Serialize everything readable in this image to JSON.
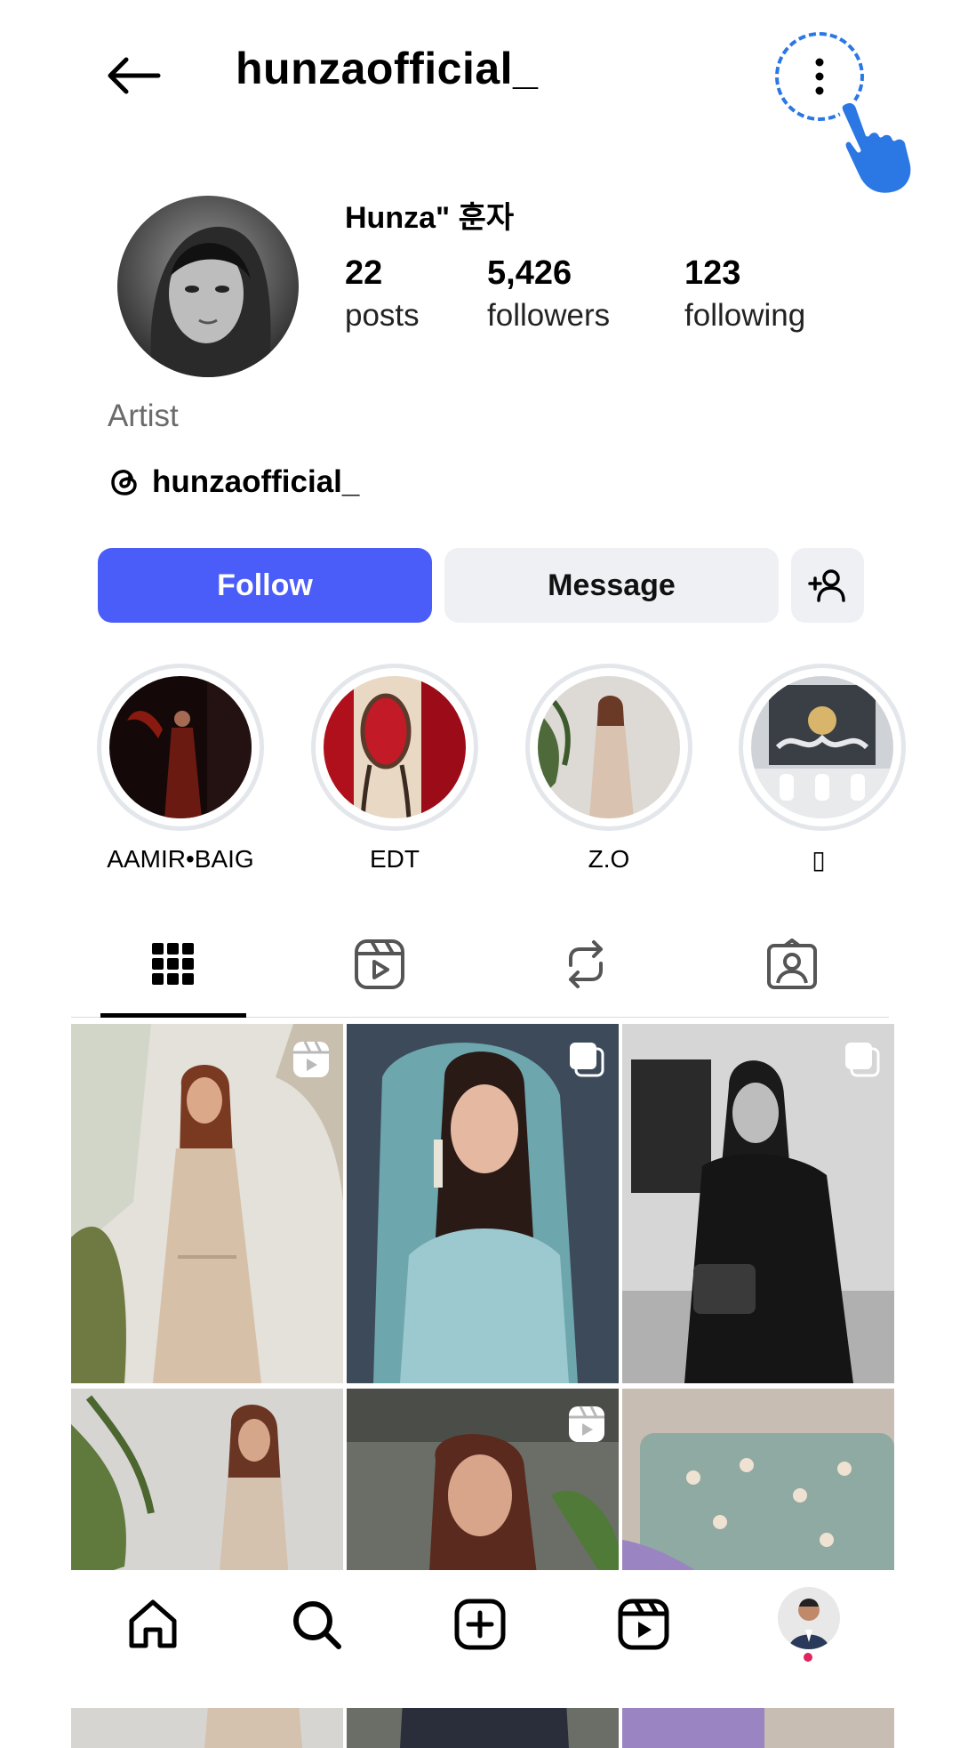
{
  "header": {
    "username": "hunzaofficial_",
    "back_icon": "arrow-left-icon",
    "more_icon": "more-vertical-icon",
    "pointer_icon": "hand-pointer-icon"
  },
  "profile": {
    "display_name": "Hunza\" 훈자",
    "category": "Artist",
    "threads_handle": "hunzaofficial_",
    "stats": [
      {
        "value": "22",
        "label": "posts"
      },
      {
        "value": "5,426",
        "label": "followers"
      },
      {
        "value": "123",
        "label": "following"
      }
    ]
  },
  "actions": {
    "follow_label": "Follow",
    "message_label": "Message",
    "add_user_icon": "add-user-icon"
  },
  "highlights": [
    {
      "label": "AAMIR•BAIG"
    },
    {
      "label": "EDT"
    },
    {
      "label": "Z.O"
    },
    {
      "label": "▯"
    }
  ],
  "tabs": [
    {
      "icon": "grid-icon",
      "selected": true
    },
    {
      "icon": "reels-icon",
      "selected": false
    },
    {
      "icon": "repost-icon",
      "selected": false
    },
    {
      "icon": "tagged-icon",
      "selected": false
    }
  ],
  "posts": [
    {
      "badge": "reel-icon"
    },
    {
      "badge": "carousel-icon"
    },
    {
      "badge": "carousel-icon"
    },
    {
      "badge": ""
    },
    {
      "badge": "reel-icon"
    },
    {
      "badge": ""
    }
  ],
  "bottom_nav": [
    {
      "icon": "home-icon"
    },
    {
      "icon": "search-icon"
    },
    {
      "icon": "create-icon"
    },
    {
      "icon": "reels-icon"
    },
    {
      "icon": "profile-avatar"
    }
  ],
  "colors": {
    "follow_button": "#4a5df9",
    "secondary_button": "#eef0f4",
    "highlight_ring": "#e3e6ea",
    "pointer_accent": "#2b78e4",
    "notification_dot": "#e0245e"
  }
}
